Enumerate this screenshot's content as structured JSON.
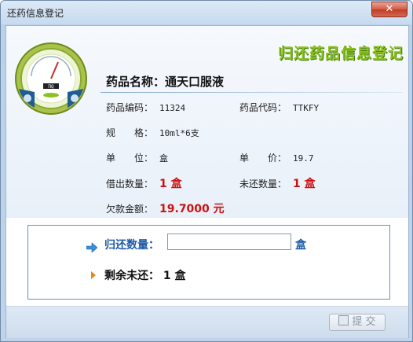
{
  "window": {
    "title": "还药信息登记",
    "close_label": "✕"
  },
  "brand": {
    "text": "归还药品信息登记"
  },
  "gauge": {
    "display": "ПQ"
  },
  "drug": {
    "name_label": "药品名称：",
    "name_value": "通天口服液",
    "code_label": "药品编码：",
    "code_value": "11324",
    "ref_label": "药品代码：",
    "ref_value": "TTKFY",
    "spec_label": "规　　格：",
    "spec_value": "10ml*6支",
    "unit_label": "单　　位：",
    "unit_value": "盒",
    "price_label": "单　　价：",
    "price_value": "19.7",
    "lent_label": "借出数量：",
    "lent_value": "1 盒",
    "unreturned_label": "未还数量：",
    "unreturned_value": "1 盒",
    "debt_label": "欠款金额：",
    "debt_value": "19.7000 元"
  },
  "return_form": {
    "qty_label": "归还数量：",
    "qty_value": "",
    "qty_unit": "盒",
    "remain_label": "剩余未还：",
    "remain_value": "1 盒"
  },
  "footer": {
    "submit_label": "提 交"
  },
  "colors": {
    "accent": "#1d5aa8",
    "alert": "#cc1111",
    "brand_green": "#8bc21e"
  }
}
